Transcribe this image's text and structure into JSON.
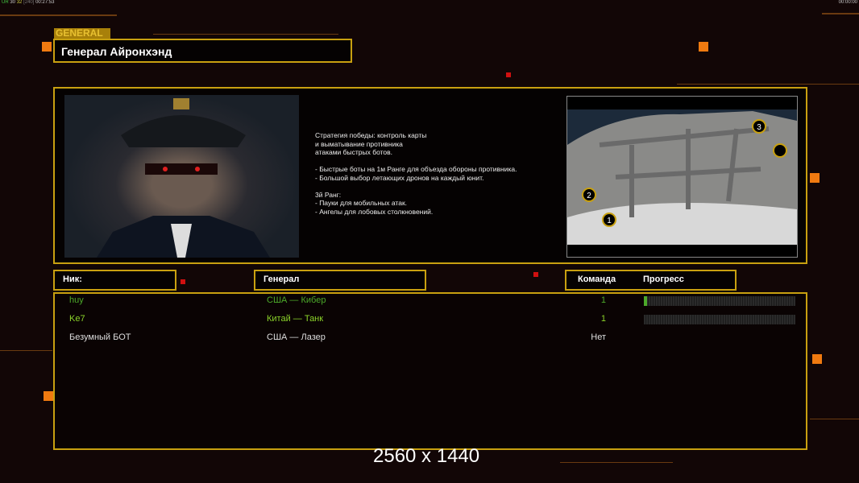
{
  "hud": {
    "fps_label": "UR",
    "fps1": "30",
    "fps2": "32",
    "fps3": "[240]",
    "time": "00:27:53",
    "clock_right": "00:00:00"
  },
  "general": {
    "tag": "GENERAL",
    "name": "Генерал Айронхэнд",
    "description": [
      "Стратегия победы: контроль карты",
      "и выматывание противника",
      "атаками быстрых ботов.",
      "",
      "- Быстрые боты на 1м Ранге для объезда обороны противника.",
      "- Большой выбор летающих дронов на каждый юнит.",
      "",
      "3й Ранг:",
      "- Пауки для мобильных атак.",
      "- Ангелы для лобовых столкновений."
    ]
  },
  "map": {
    "slots": [
      "1",
      "2",
      "3"
    ]
  },
  "table": {
    "headers": {
      "nick": "Ник:",
      "general": "Генерал",
      "team": "Команда",
      "progress": "Прогресс"
    },
    "rows": [
      {
        "nick": "huy",
        "general": "США — Кибер",
        "team": "1",
        "progress": 0.02,
        "color": "#4caa2a"
      },
      {
        "nick": "Ke7",
        "general": "Китай — Танк",
        "team": "1",
        "progress": 0,
        "color": "#8cd42a"
      },
      {
        "nick": "Безумный БОТ",
        "general": "США — Лазер",
        "team": "Нет",
        "color": "#dddddd"
      }
    ]
  },
  "watermark": "2560 x 1440"
}
